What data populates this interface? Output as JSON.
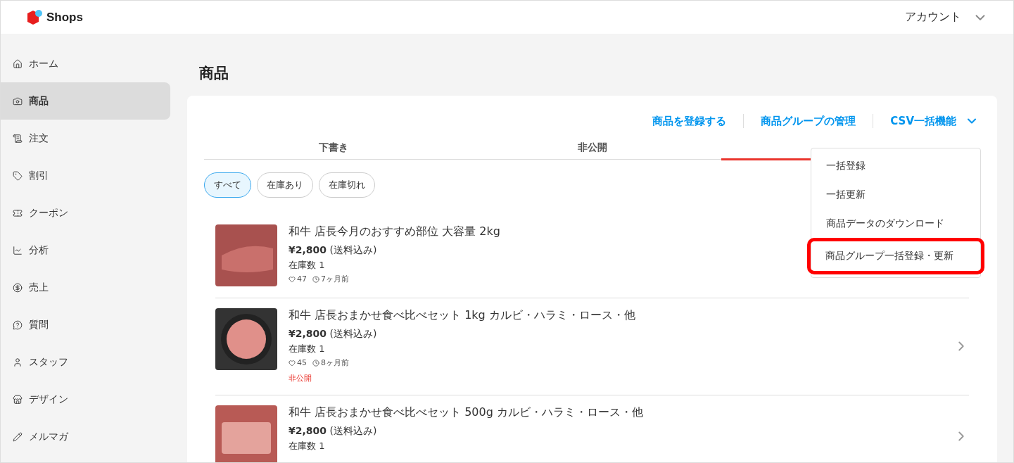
{
  "header": {
    "logo_text": "Shops",
    "account": "アカウント"
  },
  "sidebar": {
    "items": [
      {
        "label": "ホーム",
        "selected": false
      },
      {
        "label": "商品",
        "selected": true
      },
      {
        "label": "注文",
        "selected": false
      },
      {
        "label": "割引",
        "selected": false
      },
      {
        "label": "クーポン",
        "selected": false
      },
      {
        "label": "分析",
        "selected": false
      },
      {
        "label": "売上",
        "selected": false
      },
      {
        "label": "質問",
        "selected": false
      },
      {
        "label": "スタッフ",
        "selected": false
      },
      {
        "label": "デザイン",
        "selected": false
      },
      {
        "label": "メルマガ",
        "selected": false
      }
    ]
  },
  "page_title": "商品",
  "actions": [
    {
      "label": "商品を登録する",
      "kind": "link"
    },
    {
      "label": "商品グループの管理",
      "kind": "link"
    },
    {
      "label": "CSV一括機能",
      "kind": "dropdown"
    }
  ],
  "tabs": [
    {
      "label": "下書き",
      "selected": false
    },
    {
      "label": "非公開",
      "selected": false
    },
    {
      "selected": true
    }
  ],
  "filters": [
    {
      "label": "すべて",
      "selected": true
    },
    {
      "label": "在庫あり",
      "selected": false
    },
    {
      "label": "在庫切れ",
      "selected": false
    }
  ],
  "products": [
    {
      "title": "和牛 店長今月のおすすめ部位 大容量 2kg",
      "price": "¥2,800",
      "price_note": "(送料込み)",
      "stock": "在庫数 1",
      "likes": "47",
      "age": "7ヶ月前"
    },
    {
      "title": "和牛 店長おまかせ食べ比べセット 1kg カルビ・ハラミ・ロース・他",
      "price": "¥2,800",
      "price_note": "(送料込み)",
      "stock": "在庫数 1",
      "likes": "45",
      "age": "8ヶ月前",
      "status": "非公開"
    },
    {
      "title": "和牛 店長おまかせ食べ比べセット 500g カルビ・ハラミ・ロース・他",
      "price": "¥2,800",
      "price_note": "(送料込み)",
      "stock": "在庫数 1"
    }
  ],
  "csv_menu": [
    {
      "label": "一括登録",
      "highlighted": false
    },
    {
      "label": "一括更新",
      "highlighted": false
    },
    {
      "label": "商品データのダウンロード",
      "highlighted": false
    },
    {
      "label": "商品グループ一括登録・更新",
      "highlighted": true
    }
  ]
}
